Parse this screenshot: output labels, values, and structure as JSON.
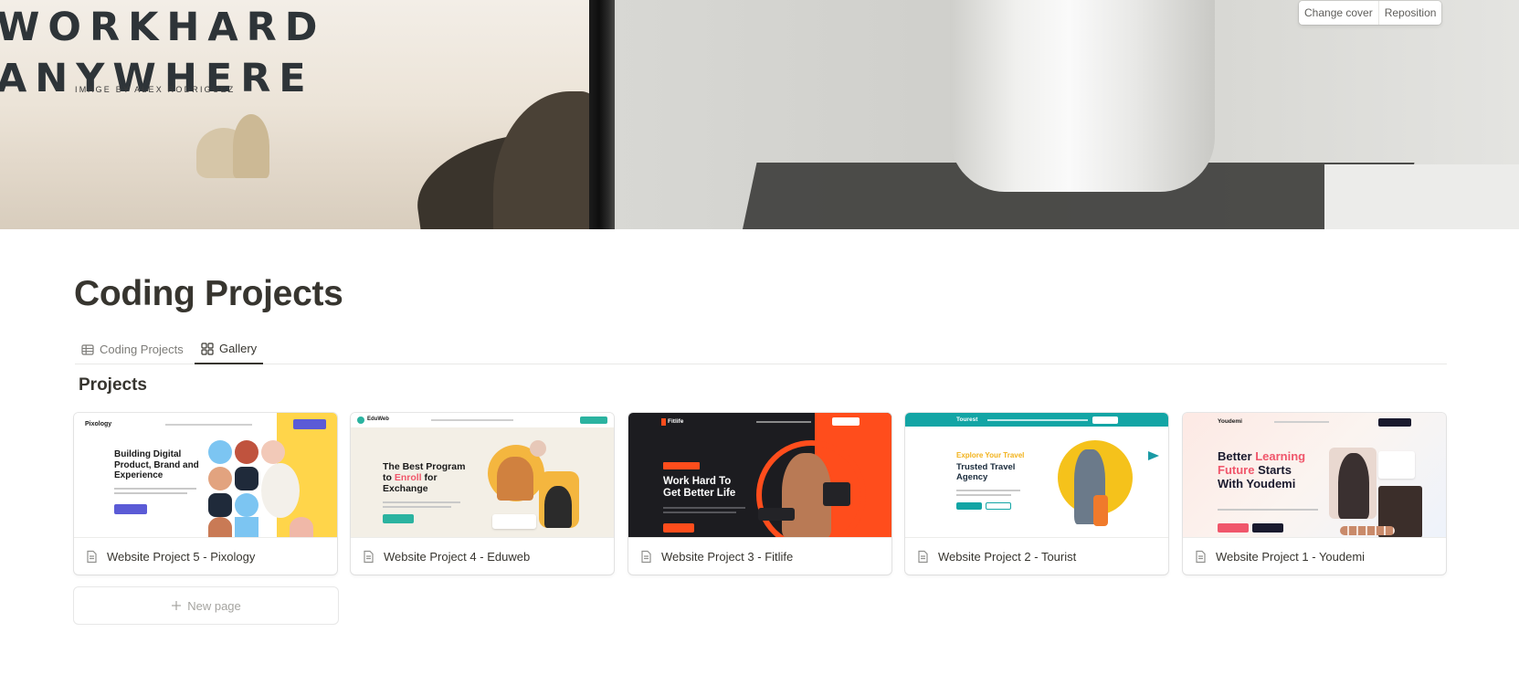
{
  "cover": {
    "headline_line1": "WORKHARD",
    "headline_line2": "ANYWHERE",
    "credit": "IMAGE BY ALEX RODRIGUEZ",
    "change_cover_label": "Change cover",
    "reposition_label": "Reposition"
  },
  "page": {
    "title": "Coding Projects",
    "tabs": [
      {
        "label": "Coding Projects",
        "icon": "table-icon",
        "active": false
      },
      {
        "label": "Gallery",
        "icon": "gallery-icon",
        "active": true
      }
    ],
    "section_title": "Projects"
  },
  "gallery": {
    "cards": [
      {
        "title": "Website Project 5 - Pixology",
        "preview": {
          "logo": "Pixology",
          "hero": [
            "Building Digital",
            "Product, Brand and",
            "Experience"
          ],
          "accent": "#5b5bd6"
        }
      },
      {
        "title": "Website Project 4 - Eduweb",
        "preview": {
          "logo": "EduWeb",
          "hero_before": "The Best Program",
          "hero_to": "to",
          "hero_accent": "Enroll",
          "hero_after": "for",
          "hero_last": "Exchange",
          "accent": "#2bb3a0"
        }
      },
      {
        "title": "Website Project 3 - Fitlife",
        "preview": {
          "logo": "Fitlife",
          "hero": [
            "Work Hard To",
            "Get Better Life"
          ],
          "accent": "#ff4d1c"
        }
      },
      {
        "title": "Website Project 2 - Tourist",
        "preview": {
          "logo": "Tourest",
          "eyebrow": "Explore Your Travel",
          "hero": [
            "Trusted Travel",
            "Agency"
          ],
          "accent": "#13a5a5"
        }
      },
      {
        "title": "Website Project 1 - Youdemi",
        "preview": {
          "logo": "Youdemi",
          "hero_a": "Better",
          "hero_b": "Learning",
          "hero_c": "Future",
          "hero_d": "Starts",
          "hero_e": "With Youdemi",
          "accent": "#f0566b"
        }
      }
    ],
    "new_page_label": "New page"
  },
  "colors": {
    "text": "#37352f",
    "muted": "#7d7c78",
    "border": "#e9e9e7"
  }
}
